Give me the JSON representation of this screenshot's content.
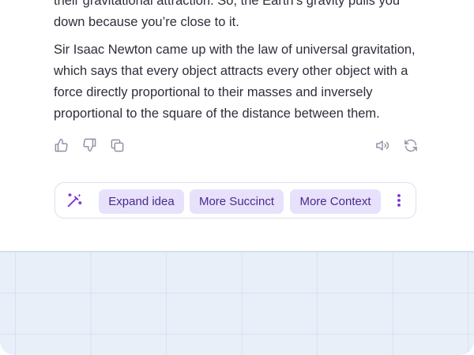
{
  "response": {
    "paragraph_1": "their gravitational attraction. So, the Earth’s gravity pulls you down because you’re close to it.",
    "paragraph_2": "Sir Isaac Newton came up with the law of universal gravitation, which says that every object attracts every other object with a force directly proportional to their masses and inversely proportional to the square of the distance between them."
  },
  "feedback_icons": [
    "thumbs-up-icon",
    "thumbs-down-icon",
    "copy-icon",
    "speaker-icon",
    "regenerate-icon"
  ],
  "action_bar": {
    "magic_icon": "magic-wand-icon",
    "chips": {
      "expand": "Expand idea",
      "succinct": "More Succinct",
      "context": "More Context"
    },
    "more_icon": "more-vertical-icon"
  },
  "colors": {
    "text": "#2d2f3a",
    "icon": "#8b90a3",
    "accent": "#7b2fd6",
    "chip_bg": "#e7e1fb",
    "chip_text": "#4a2a8c",
    "grid_bg": "#e8eff9"
  }
}
